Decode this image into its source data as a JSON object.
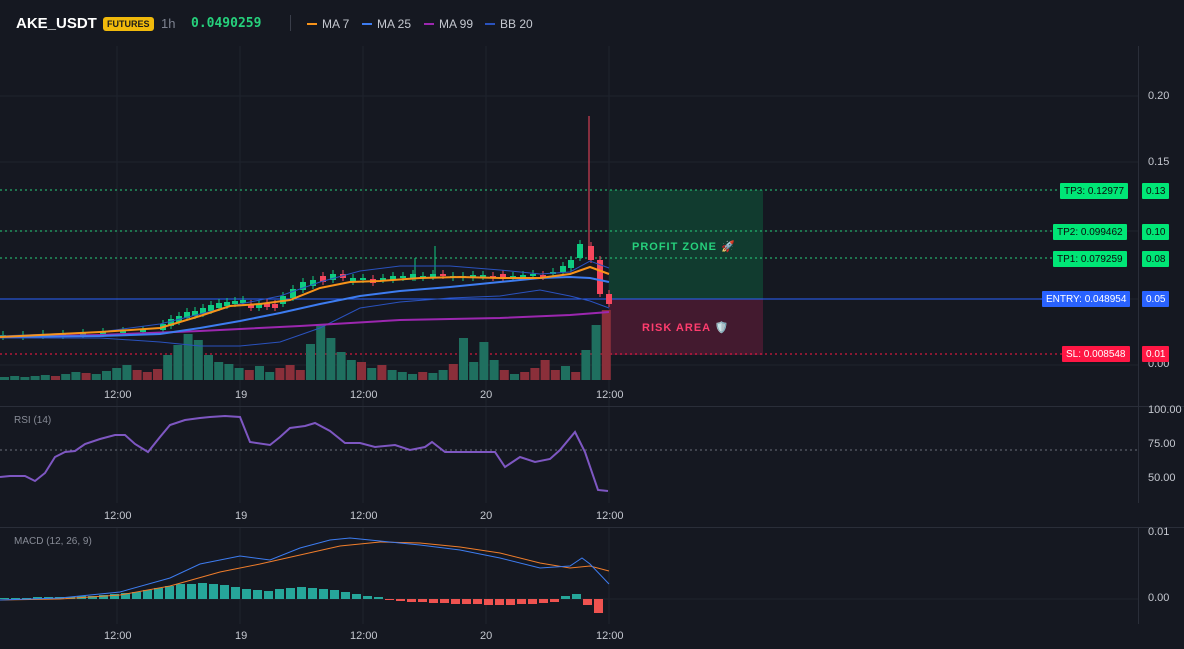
{
  "header": {
    "symbol": "AKE_USDT",
    "badge": "FUTURES",
    "timeframe": "1h",
    "price": "0.0490259",
    "legend": [
      {
        "label": "MA 7",
        "color": "#f7931a"
      },
      {
        "label": "MA 25",
        "color": "#3d7cf0"
      },
      {
        "label": "MA 99",
        "color": "#9c27b0"
      },
      {
        "label": "BB 20",
        "color": "#2a52be"
      }
    ]
  },
  "main": {
    "y_ticks": [
      "0.20",
      "0.15",
      "0.10",
      "0.05",
      "0.00"
    ],
    "x_ticks": [
      "12:00",
      "19",
      "12:00",
      "20",
      "12:00"
    ],
    "zones": {
      "profit": "PROFIT ZONE 🚀",
      "risk": "RISK AREA 🛡️"
    },
    "levels": [
      {
        "label": "TP3: 0.12977",
        "axis": "0.13",
        "color": "#00e676"
      },
      {
        "label": "TP2: 0.099462",
        "axis": "0.10",
        "color": "#00e676"
      },
      {
        "label": "TP1: 0.079259",
        "axis": "0.08",
        "color": "#00e676"
      },
      {
        "label": "ENTRY: 0.048954",
        "axis": "0.05",
        "color": "#2962ff"
      },
      {
        "label": "SL: 0.008548",
        "axis": "0.01",
        "color": "#ff1744"
      }
    ]
  },
  "rsi": {
    "label": "RSI (14)",
    "y_ticks": [
      "100.00",
      "75.00",
      "50.00"
    ],
    "x_ticks": [
      "12:00",
      "19",
      "12:00",
      "20",
      "12:00"
    ]
  },
  "macd": {
    "label": "MACD (12, 26, 9)",
    "y_ticks": [
      "0.01",
      "0.00"
    ],
    "x_ticks": [
      "12:00",
      "19",
      "12:00",
      "20",
      "12:00"
    ]
  },
  "colors": {
    "up": "#26a69a",
    "down": "#ef5350",
    "candle_up": "#0ecb81",
    "candle_down": "#f6465d"
  }
}
